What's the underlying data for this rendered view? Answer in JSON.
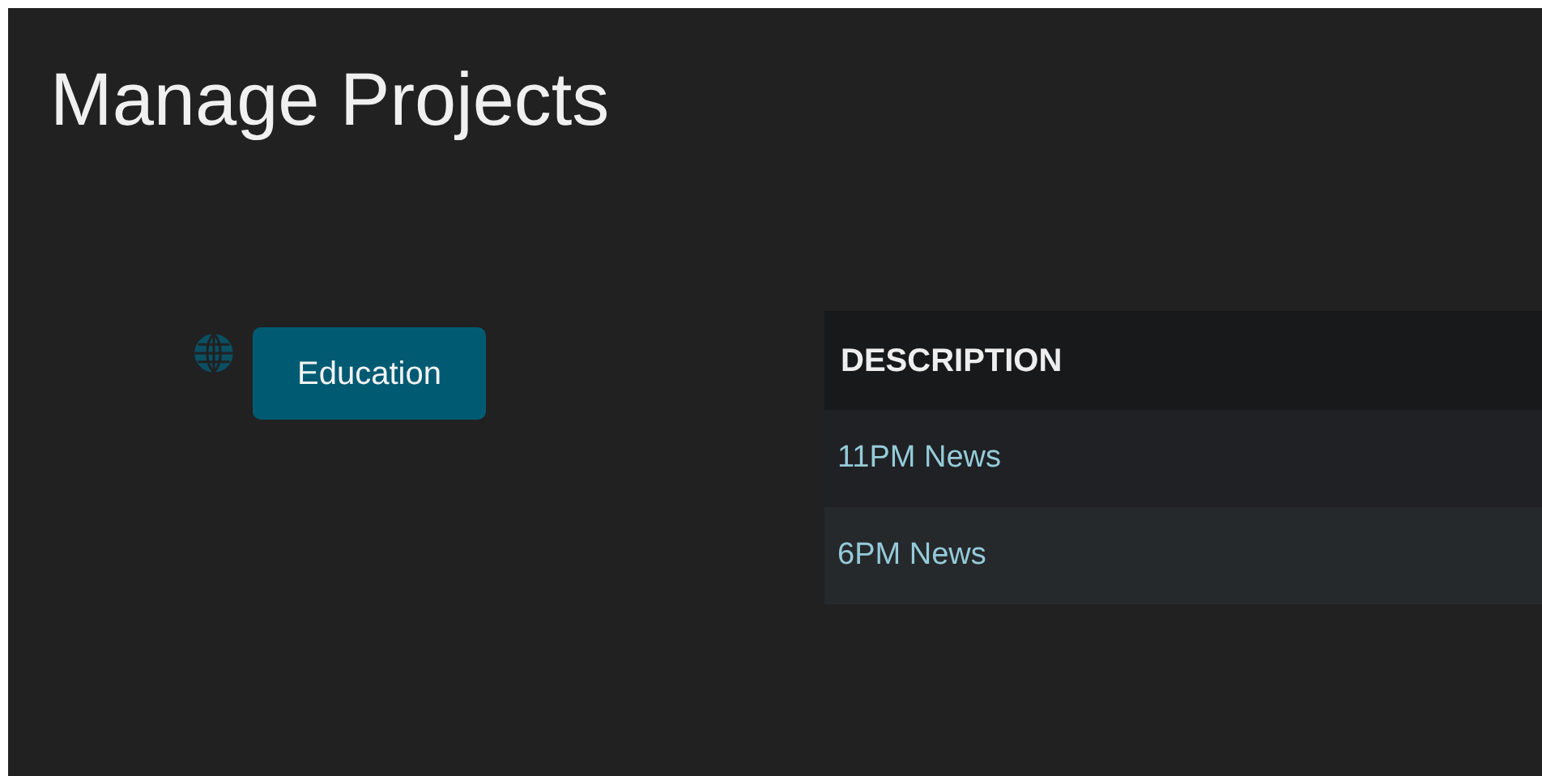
{
  "title": "Manage Projects",
  "projects": [
    {
      "label": "Education"
    }
  ],
  "table": {
    "columns": [
      "DESCRIPTION"
    ],
    "rows": [
      {
        "description": "11PM News"
      },
      {
        "description": "6PM News"
      }
    ]
  }
}
